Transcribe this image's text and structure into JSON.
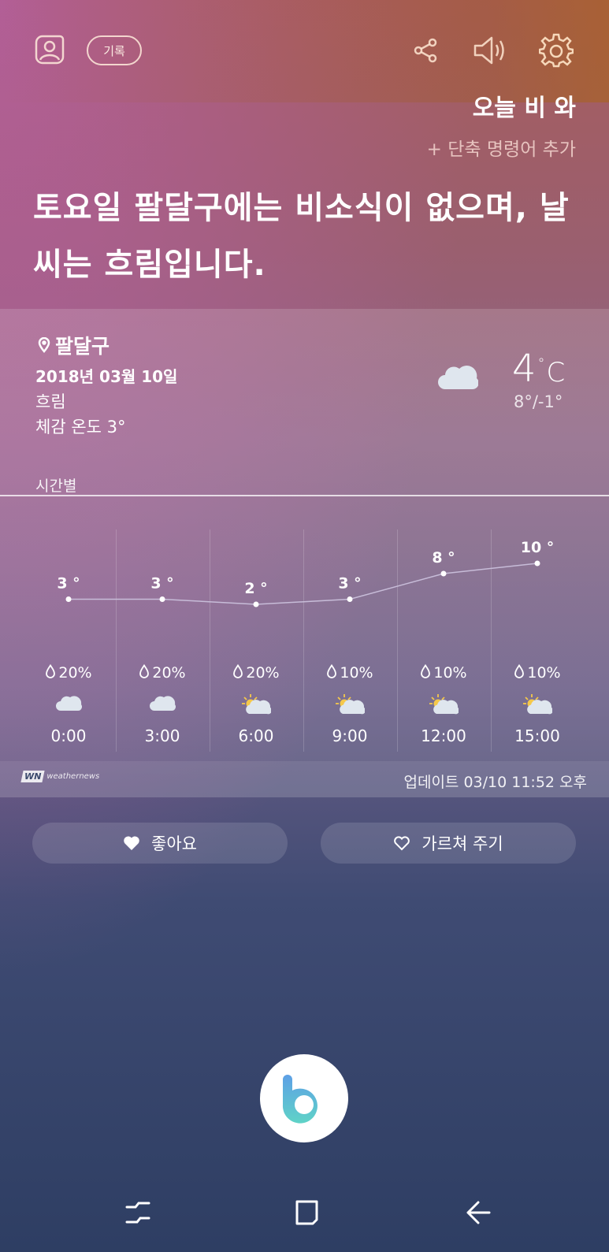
{
  "header": {
    "history_label": "기록",
    "icons": [
      "profile-icon",
      "share-icon",
      "speaker-icon",
      "gear-icon"
    ]
  },
  "query": "오늘 비 와",
  "shortcut_label": "+ 단축 명령어 추가",
  "answer": "토요일 팔달구에는 비소식이 없으며, 날씨는 흐림입니다.",
  "weather": {
    "location": "팔달구",
    "date": "2018년 03월 10일",
    "condition": "흐림",
    "feels_like": "체감 온도 3°",
    "temperature": "4",
    "unit": "C",
    "degree": "°",
    "high_low": "8°/-1°",
    "hourly_label": "시간별",
    "hourly": [
      {
        "time": "0:00",
        "temp": "3 °",
        "rain": "20%",
        "icon": "cloud-icon"
      },
      {
        "time": "3:00",
        "temp": "3 °",
        "rain": "20%",
        "icon": "cloud-icon"
      },
      {
        "time": "6:00",
        "temp": "2 °",
        "rain": "20%",
        "icon": "sun-cloud-icon"
      },
      {
        "time": "9:00",
        "temp": "3 °",
        "rain": "10%",
        "icon": "sun-cloud-icon"
      },
      {
        "time": "12:00",
        "temp": "8 °",
        "rain": "10%",
        "icon": "sun-cloud-icon"
      },
      {
        "time": "15:00",
        "temp": "10 °",
        "rain": "10%",
        "icon": "sun-cloud-icon"
      }
    ],
    "hourly_values": [
      3,
      3,
      2,
      3,
      8,
      10
    ]
  },
  "provider": {
    "logo_box": "WN",
    "logo_text": "weathernews",
    "update_text": "업데이트  03/10 11:52 오후"
  },
  "actions": {
    "like_label": "좋아요",
    "teach_label": "가르쳐 주기"
  },
  "colors": {
    "accent_line": "#c7bcd8",
    "bixby_gradient": [
      "#5ea0e6",
      "#5fd3c7"
    ]
  }
}
